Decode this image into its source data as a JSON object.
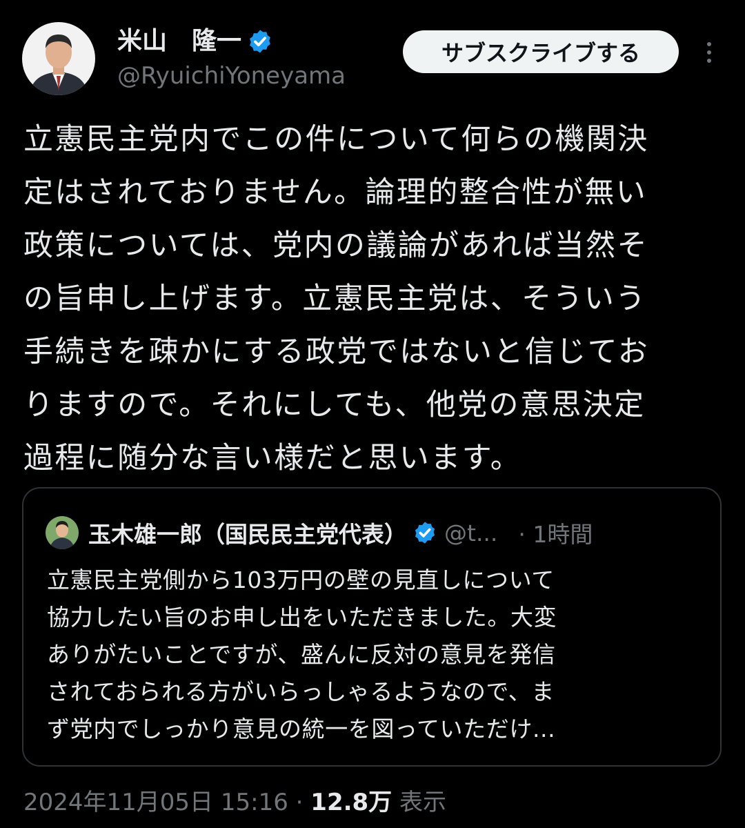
{
  "author": {
    "display_name": "米山　隆一",
    "handle": "@RyuichiYoneyama",
    "verified": true
  },
  "actions": {
    "subscribe_label": "サブスクライブする",
    "more_icon": "more-vertical-icon"
  },
  "tweet": {
    "lines": [
      "立憲民主党内でこの件について何らの機関決",
      "定はされておりません。論理的整合性が無い",
      "政策については、党内の議論があれば当然そ",
      "の旨申し上げます。立憲民主党は、そういう",
      "手続きを疎かにする政党ではないと信じてお",
      "りますので。それにしても、他党の意思決定",
      "過程に随分な言い様だと思います。"
    ]
  },
  "quote": {
    "display_name": "玉木雄一郎（国民民主党代表）",
    "handle": "@t...",
    "time": "· 1時間",
    "verified": true,
    "lines": [
      "立憲民主党側から103万円の壁の見直しについて",
      "協力したい旨のお申し出をいただきました。大変",
      "ありがたいことですが、盛んに反対の意見を発信",
      "されておられる方がいらっしゃるようなので、ま",
      "ず党内でしっかり意見の統一を図っていただけ..."
    ]
  },
  "meta": {
    "datetime": "2024年11月05日 15:16",
    "separator": "·",
    "views_count": "12.8万",
    "views_label": "表示"
  },
  "colors": {
    "background": "#000000",
    "text": "#e7e9ea",
    "secondary": "#71767b",
    "verified_badge": "#1d9bf0",
    "border": "#2f3336"
  }
}
